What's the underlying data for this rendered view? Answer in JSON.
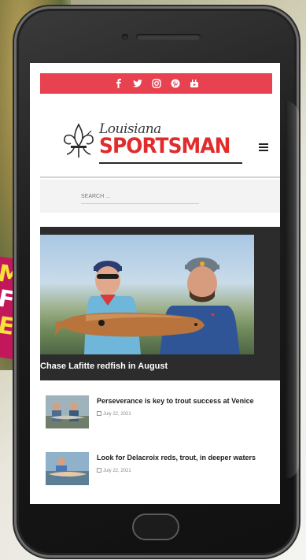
{
  "background": {
    "banner_lines": [
      "MA",
      "F",
      "EL"
    ],
    "banner_color": "#c2185b"
  },
  "social": {
    "bar_color": "#e8414f",
    "icons": [
      "facebook-icon",
      "twitter-icon",
      "instagram-icon",
      "pinterest-icon",
      "youtube-icon"
    ]
  },
  "logo": {
    "script": "Louisiana",
    "main": "SPORTSMAN",
    "accent_color": "#e02c2c"
  },
  "search": {
    "placeholder": "SEARCH ..."
  },
  "hero": {
    "title": "Chase Lafitte redfish in August"
  },
  "articles": [
    {
      "title": "Perseverance is key to trout success at Venice",
      "date": "July 22, 2021"
    },
    {
      "title": "Look for Delacroix reds, trout, in deeper waters",
      "date": "July 22, 2021"
    }
  ]
}
